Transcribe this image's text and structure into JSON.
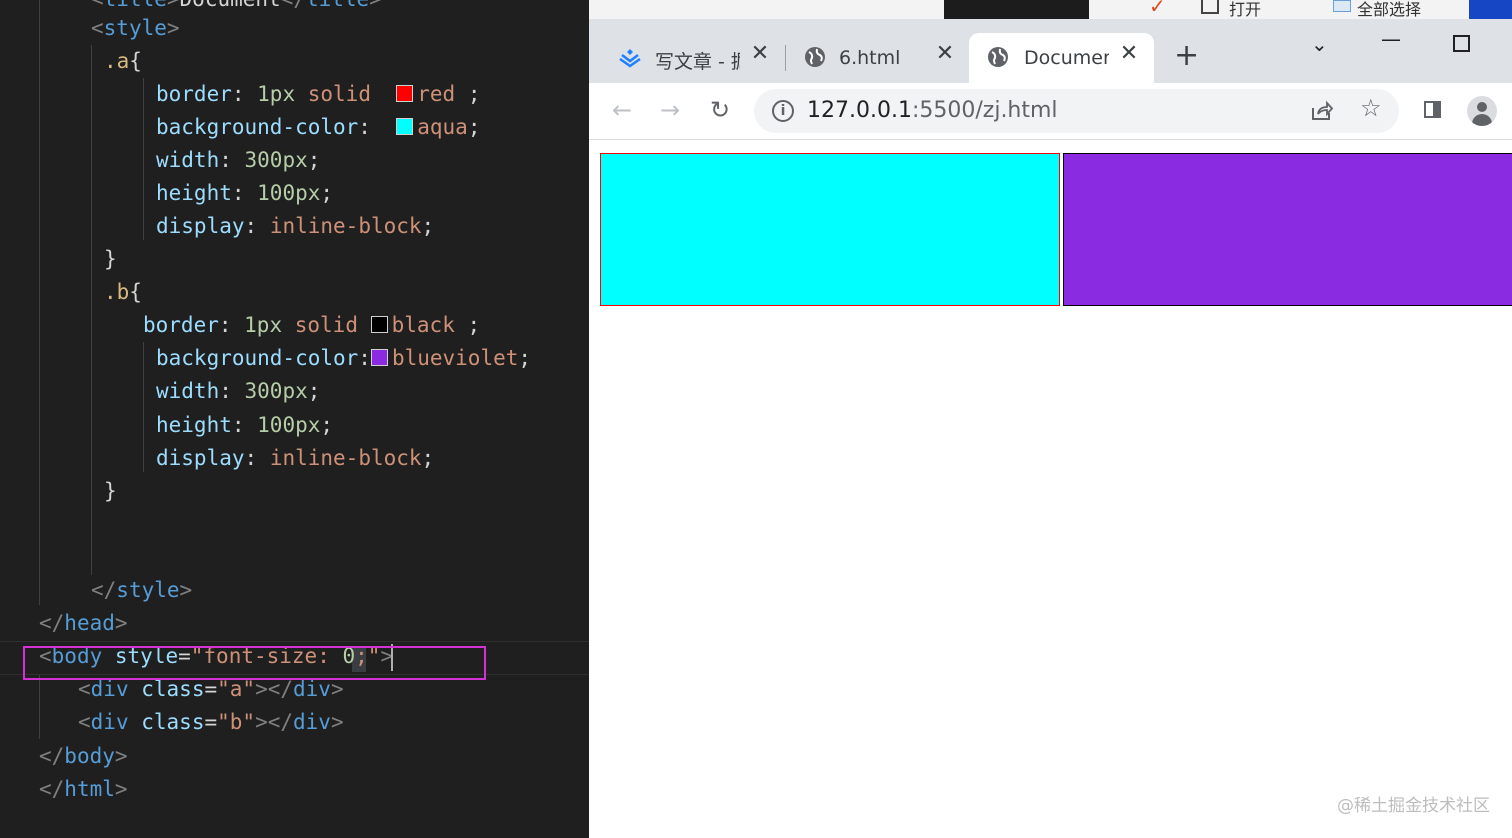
{
  "editor": {
    "lines": {
      "l0": [
        "<title>Document</title>"
      ],
      "style_open_a": "<",
      "style_open_b": "style",
      "style_open_c": ">",
      "a_sel": ".a",
      "b_sel": ".b",
      "open_brace": "{",
      "close_brace": "}",
      "border_prop": "border",
      "bgc_prop": "background-color",
      "width_prop": "width",
      "height_prop": "height",
      "display_prop": "display",
      "colon": ":",
      "semi": ";",
      "px1": "1px",
      "solid": "solid",
      "red": "red",
      "black": "black",
      "aqua": "aqua",
      "blueviolet": "blueviolet",
      "w300": "300px",
      "h100": "100px",
      "inline_block": "inline-block",
      "style_close": "style",
      "head_close": "head",
      "body_tag": "body",
      "style_attr": "style",
      "eq": "=",
      "font_style_val_a": "\"font-size: ",
      "font_style_val_zero": "0",
      "font_style_val_b": ";\"",
      "div_tag": "div",
      "class_attr": "class",
      "cls_a": "\"a\"",
      "cls_b": "\"b\"",
      "html_tag": "html"
    },
    "swatch_colors": {
      "red": "#ff0000",
      "aqua": "#00ffff",
      "black": "#000000",
      "blueviolet": "#8a2be2"
    },
    "highlight_color": "#d52fd6"
  },
  "background_app": {
    "open_label": "打开",
    "select_all_label": "全部选择"
  },
  "browser": {
    "tabs": [
      {
        "title": "写文章 - 掘",
        "icon": "juejin-logo-icon",
        "active": false
      },
      {
        "title": "6.html",
        "icon": "globe-icon",
        "active": false
      },
      {
        "title": "Documen",
        "icon": "globe-icon",
        "active": true
      }
    ],
    "new_tab": "+",
    "url_host": "127.0.0.1",
    "url_path": ":5500/zj.html",
    "boxes": [
      {
        "class": "a",
        "background": "#00ffff",
        "border": "#ff0000"
      },
      {
        "class": "b",
        "background": "#8a2be2",
        "border": "#000000"
      }
    ],
    "watermark": "@稀土掘金技术社区"
  }
}
